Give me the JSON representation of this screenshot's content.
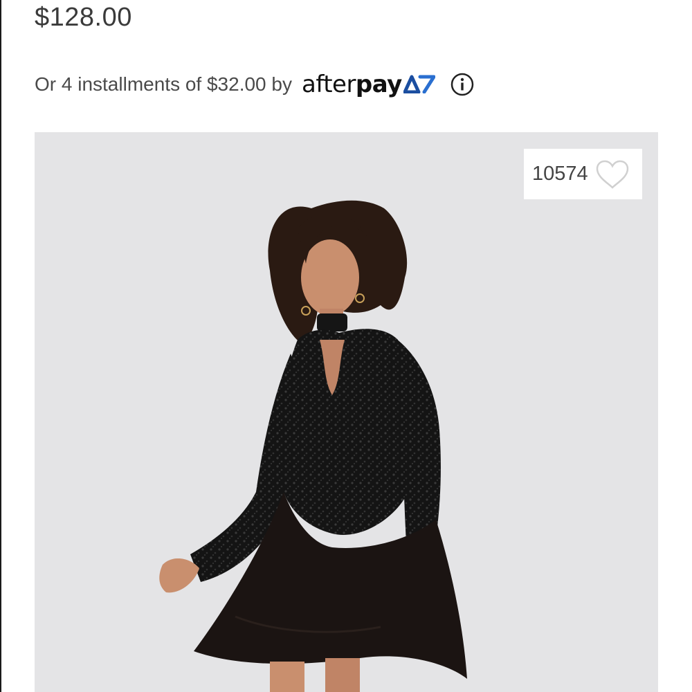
{
  "product": {
    "price": "$128.00",
    "installments_text": "Or 4 installments of $32.00 by",
    "afterpay": {
      "brand_after": "after",
      "brand_pay": "pay",
      "brand_color": "#111111",
      "mark_color": "#1b4ea0",
      "info_icon": "info-circle-icon"
    },
    "image": {
      "background_color": "#e4e4e6",
      "likes_count": "10574",
      "favorite_icon": "heart-outline-icon"
    }
  }
}
